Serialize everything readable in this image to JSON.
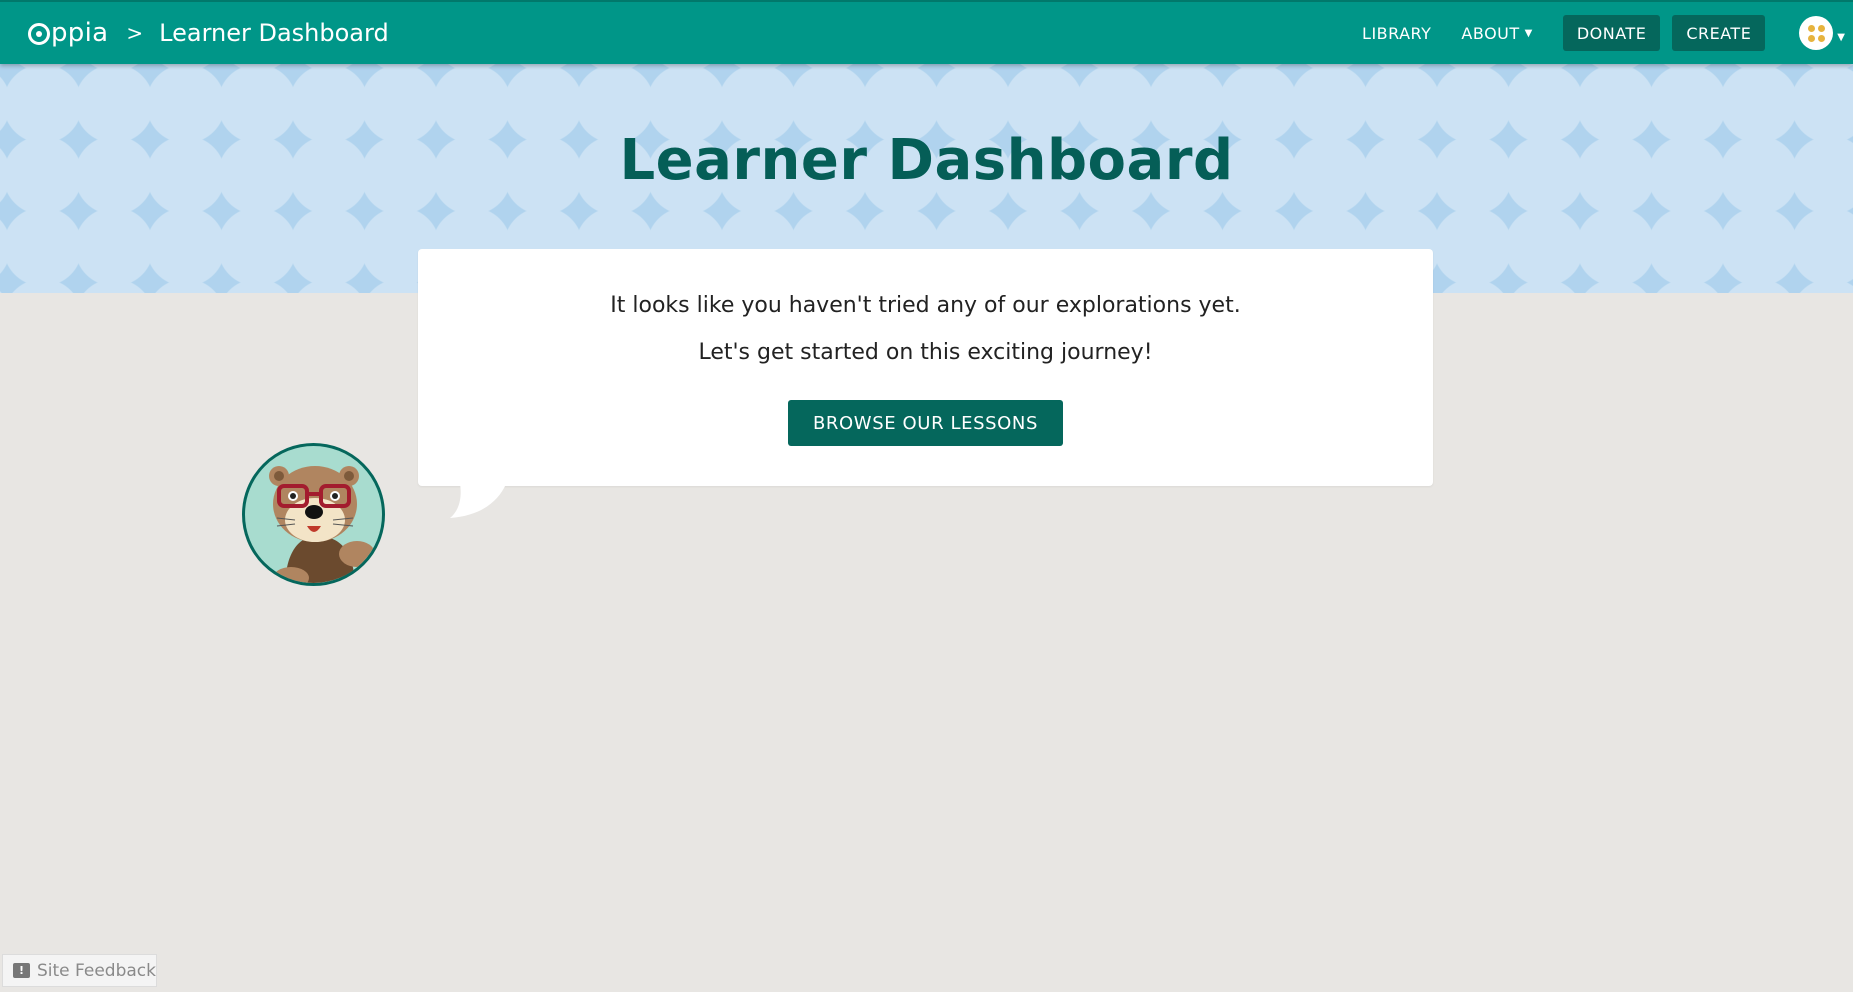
{
  "nav": {
    "logo_text": "ppia",
    "separator": ">",
    "breadcrumb_title": "Learner Dashboard",
    "links": {
      "library": "LIBRARY",
      "about": "ABOUT",
      "donate": "DONATE",
      "create": "CREATE"
    }
  },
  "banner": {
    "title": "Learner Dashboard"
  },
  "card": {
    "message_line1": "It looks like you haven't tried any of our explorations yet.",
    "message_line2": "Let's get started on this exciting journey!",
    "browse_button": "BROWSE OUR LESSONS"
  },
  "footer": {
    "feedback_label": "Site Feedback"
  },
  "icons": {
    "about_caret": "chevron-down-icon",
    "profile_caret": "chevron-down-icon",
    "feedback": "feedback-icon",
    "mascot": "otter-mascot"
  },
  "colors": {
    "navbar": "#009688",
    "button_dark": "#05675c",
    "title_text": "#055e57",
    "banner_bg": "#b0d3ee",
    "page_bg": "#e8e6e3"
  }
}
